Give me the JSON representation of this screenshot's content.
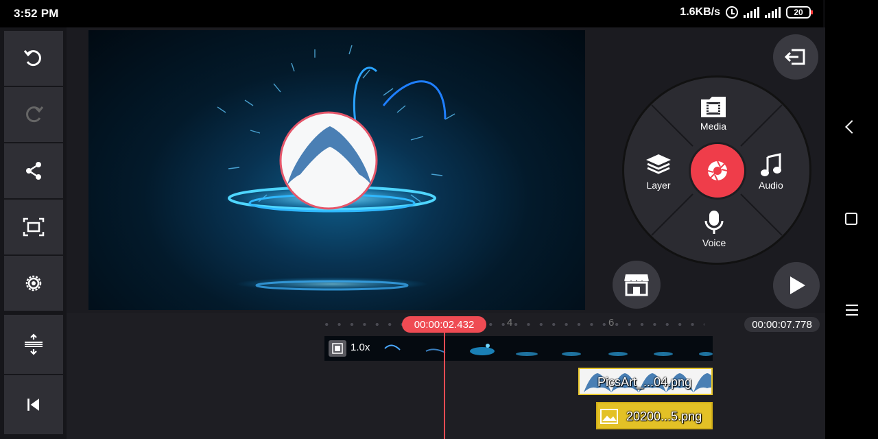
{
  "status_bar": {
    "time": "3:52 PM",
    "network_speed": "1.6KB/s",
    "battery_level": "20",
    "icons": [
      "alarm-icon",
      "signal-icon",
      "signal-icon",
      "battery-icon"
    ]
  },
  "left_toolbar": {
    "items": [
      "undo-icon",
      "redo-icon",
      "share-icon",
      "aspect-ratio-icon",
      "settings-icon"
    ],
    "bottom_items": [
      "timeline-expand-icon",
      "skip-to-start-icon"
    ]
  },
  "media_wheel": {
    "media_label": "Media",
    "layer_label": "Layer",
    "audio_label": "Audio",
    "voice_label": "Voice"
  },
  "timeline": {
    "current_time": "00:00:02.432",
    "total_time": "00:00:07.778",
    "ruler_marks": [
      "4",
      "6"
    ],
    "video_clip": {
      "speed": "1.0x"
    },
    "layer_clips": [
      {
        "name": "PicsArt_...04.png"
      },
      {
        "name": "20200...5.png"
      }
    ]
  },
  "colors": {
    "accent": "#ef4b53",
    "panel": "#2f2f35",
    "layer_clip_highlight": "#e3c126"
  }
}
